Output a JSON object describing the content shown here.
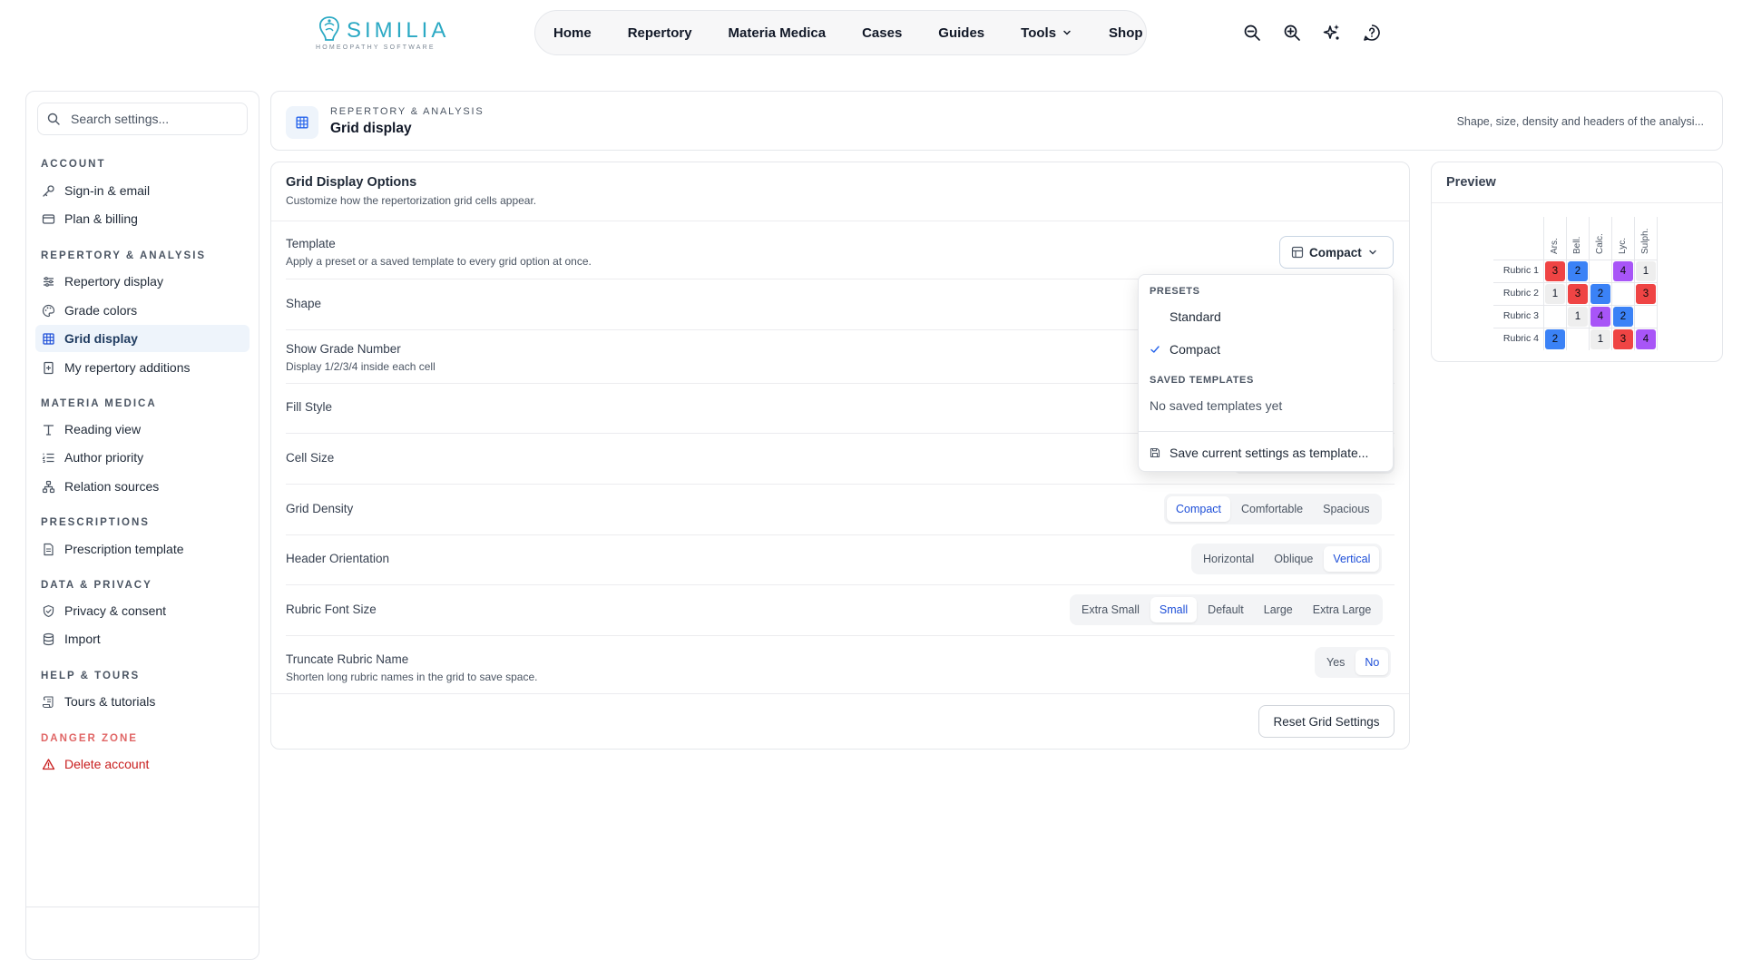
{
  "brand": {
    "name": "SIMILIA",
    "tagline": "HOMEOPATHY SOFTWARE",
    "color": "#2ba9c4"
  },
  "nav": {
    "items": [
      "Home",
      "Repertory",
      "Materia Medica",
      "Cases",
      "Guides",
      "Tools",
      "Shop"
    ],
    "tools_has_dropdown": true
  },
  "top_icons": [
    "zoom-out-icon",
    "zoom-in-icon",
    "sparkles-icon",
    "help-icon"
  ],
  "sidebar": {
    "search_placeholder": "Search settings...",
    "sections": [
      {
        "title": "ACCOUNT",
        "items": [
          {
            "label": "Sign-in & email",
            "icon": "key-icon"
          },
          {
            "label": "Plan & billing",
            "icon": "credit-card-icon"
          }
        ]
      },
      {
        "title": "REPERTORY & ANALYSIS",
        "items": [
          {
            "label": "Repertory display",
            "icon": "sliders-icon"
          },
          {
            "label": "Grade colors",
            "icon": "palette-icon"
          },
          {
            "label": "Grid display",
            "icon": "grid-icon",
            "active": true
          },
          {
            "label": "My repertory additions",
            "icon": "file-plus-icon"
          }
        ]
      },
      {
        "title": "MATERIA MEDICA",
        "items": [
          {
            "label": "Reading view",
            "icon": "type-icon"
          },
          {
            "label": "Author priority",
            "icon": "list-ordered-icon"
          },
          {
            "label": "Relation sources",
            "icon": "network-icon"
          }
        ]
      },
      {
        "title": "PRESCRIPTIONS",
        "items": [
          {
            "label": "Prescription template",
            "icon": "file-text-icon"
          }
        ]
      },
      {
        "title": "DATA & PRIVACY",
        "items": [
          {
            "label": "Privacy & consent",
            "icon": "shield-check-icon"
          },
          {
            "label": "Import",
            "icon": "database-icon"
          }
        ]
      },
      {
        "title": "HELP & TOURS",
        "items": [
          {
            "label": "Tours & tutorials",
            "icon": "scroll-icon"
          }
        ]
      },
      {
        "title": "DANGER ZONE",
        "danger": true,
        "items": [
          {
            "label": "Delete account",
            "icon": "alert-triangle-icon"
          }
        ]
      }
    ]
  },
  "header": {
    "kicker": "REPERTORY & ANALYSIS",
    "title": "Grid display",
    "description": "Shape, size, density and headers of the analysi..."
  },
  "options": {
    "title": "Grid Display Options",
    "subtitle": "Customize how the repertorization grid cells appear.",
    "template": {
      "label": "Template",
      "sub": "Apply a preset or a saved template to every grid option at once.",
      "value": "Compact"
    },
    "shape": {
      "label": "Shape"
    },
    "grade_number": {
      "label": "Show Grade Number",
      "sub": "Display 1/2/3/4 inside each cell"
    },
    "fill_style": {
      "label": "Fill Style"
    },
    "cell_size": {
      "label": "Cell Size"
    },
    "grid_density": {
      "label": "Grid Density",
      "options": [
        "Compact",
        "Comfortable",
        "Spacious"
      ],
      "selected": "Compact"
    },
    "header_orientation": {
      "label": "Header Orientation",
      "options": [
        "Horizontal",
        "Oblique",
        "Vertical"
      ],
      "selected": "Vertical"
    },
    "rubric_font_size": {
      "label": "Rubric Font Size",
      "options": [
        "Extra Small",
        "Small",
        "Default",
        "Large",
        "Extra Large"
      ],
      "selected": "Small"
    },
    "truncate": {
      "label": "Truncate Rubric Name",
      "sub": "Shorten long rubric names in the grid to save space.",
      "options": [
        "Yes",
        "No"
      ],
      "selected": "No"
    },
    "reset_label": "Reset Grid Settings"
  },
  "dropdown": {
    "presets_heading": "PRESETS",
    "presets": [
      "Standard",
      "Compact"
    ],
    "selected": "Compact",
    "saved_heading": "SAVED TEMPLATES",
    "saved_empty": "No saved templates yet",
    "save_action": "Save current settings as template..."
  },
  "preview": {
    "title": "Preview",
    "remedies": [
      "Ars.",
      "Bell.",
      "Calc.",
      "Lyc.",
      "Sulph."
    ],
    "rubrics": [
      "Rubric 1",
      "Rubric 2",
      "Rubric 3",
      "Rubric 4"
    ],
    "grades": [
      [
        3,
        2,
        0,
        4,
        1
      ],
      [
        1,
        3,
        2,
        0,
        3
      ],
      [
        0,
        1,
        4,
        2,
        0
      ],
      [
        2,
        0,
        1,
        3,
        4
      ]
    ],
    "grade_colors": {
      "1": "#eeeeee",
      "2": "#3b82f6",
      "3": "#ef4444",
      "4": "#a855f7"
    }
  }
}
